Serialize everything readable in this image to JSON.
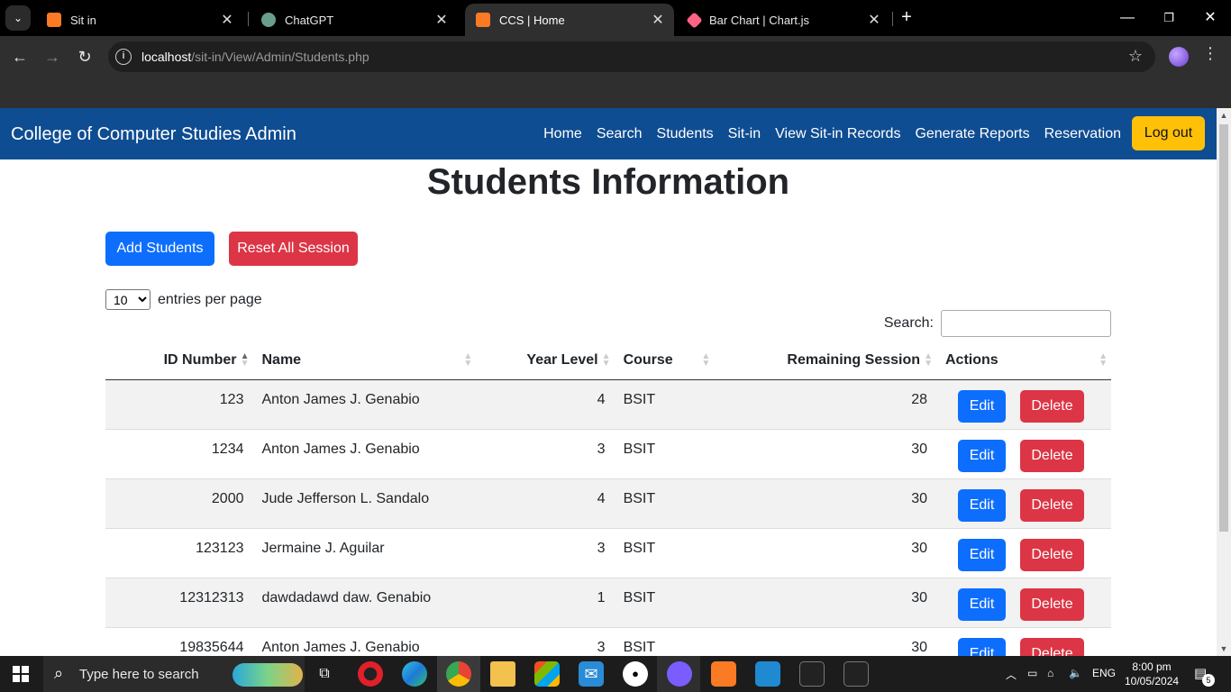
{
  "browser": {
    "tabs": [
      {
        "title": "Sit in",
        "favicon_color": "#fb7a24"
      },
      {
        "title": "ChatGPT",
        "favicon_color": "#6a9e8c"
      },
      {
        "title": "CCS | Home",
        "favicon_color": "#fb7a24"
      },
      {
        "title": "Bar Chart | Chart.js",
        "favicon_color": "#ff6384"
      }
    ],
    "url_host": "localhost",
    "url_path": "/sit-in/View/Admin/Students.php"
  },
  "navbar": {
    "brand": "College of Computer Studies Admin",
    "links": [
      "Home",
      "Search",
      "Students",
      "Sit-in",
      "View Sit-in Records",
      "Generate Reports",
      "Reservation"
    ],
    "logout": "Log out"
  },
  "page": {
    "title": "Students Information",
    "add_button": "Add Students",
    "reset_button": "Reset All Session",
    "entries_value": "10",
    "entries_label": "entries per page",
    "search_label": "Search:",
    "search_value": ""
  },
  "table": {
    "headers": [
      "ID Number",
      "Name",
      "Year Level",
      "Course",
      "Remaining Session",
      "Actions"
    ],
    "edit_label": "Edit",
    "delete_label": "Delete",
    "rows": [
      {
        "id": "123",
        "name": "Anton James J. Genabio",
        "year": "4",
        "course": "BSIT",
        "remaining": "28"
      },
      {
        "id": "1234",
        "name": "Anton James J. Genabio",
        "year": "3",
        "course": "BSIT",
        "remaining": "30"
      },
      {
        "id": "2000",
        "name": "Jude Jefferson L. Sandalo",
        "year": "4",
        "course": "BSIT",
        "remaining": "30"
      },
      {
        "id": "123123",
        "name": "Jermaine J. Aguilar",
        "year": "3",
        "course": "BSIT",
        "remaining": "30"
      },
      {
        "id": "12312313",
        "name": "dawdadawd daw. Genabio",
        "year": "1",
        "course": "BSIT",
        "remaining": "30"
      },
      {
        "id": "19835644",
        "name": "Anton James J. Genabio",
        "year": "3",
        "course": "BSIT",
        "remaining": "30"
      }
    ]
  },
  "taskbar": {
    "search_placeholder": "Type here to search",
    "lang": "ENG",
    "time": "8:00 pm",
    "date": "10/05/2024",
    "notifications": "5"
  },
  "colors": {
    "navbar": "#0f4d92",
    "primary": "#0d6efd",
    "danger": "#dc3545",
    "warning": "#ffc107"
  }
}
